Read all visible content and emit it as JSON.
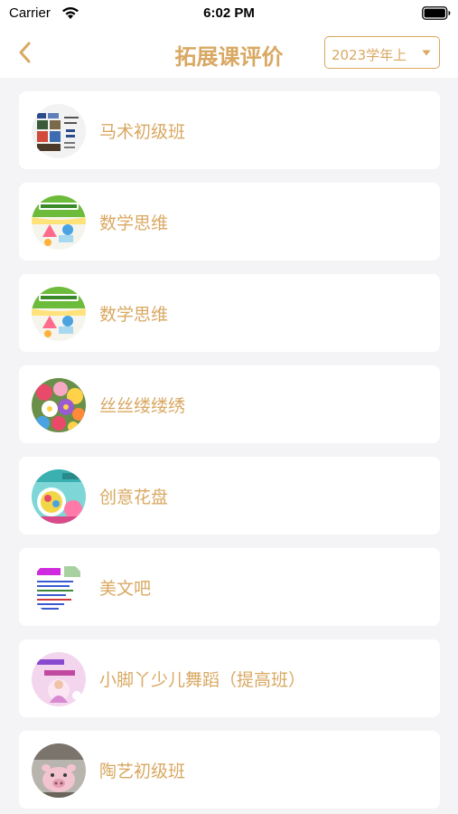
{
  "status_bar": {
    "carrier": "Carrier",
    "time": "6:02 PM"
  },
  "nav": {
    "title": "拓展课评价",
    "term_select": "2023学年上"
  },
  "courses": [
    {
      "name": "马术初级班",
      "avatar": "horse-riding-poster"
    },
    {
      "name": "数学思维",
      "avatar": "math-thinking-cover"
    },
    {
      "name": "数学思维",
      "avatar": "math-thinking-cover"
    },
    {
      "name": "丝丝缕缕绣",
      "avatar": "embroidery-flowers"
    },
    {
      "name": "创意花盘",
      "avatar": "creative-flower-plate"
    },
    {
      "name": "美文吧",
      "avatar": "essay-club-poster"
    },
    {
      "name": "小脚丫少儿舞蹈（提高班）",
      "avatar": "kids-dance-poster"
    },
    {
      "name": "陶艺初级班",
      "avatar": "pottery-pig"
    }
  ],
  "colors": {
    "accent": "#d9a862",
    "background": "#f4f4f6",
    "card": "#ffffff"
  }
}
